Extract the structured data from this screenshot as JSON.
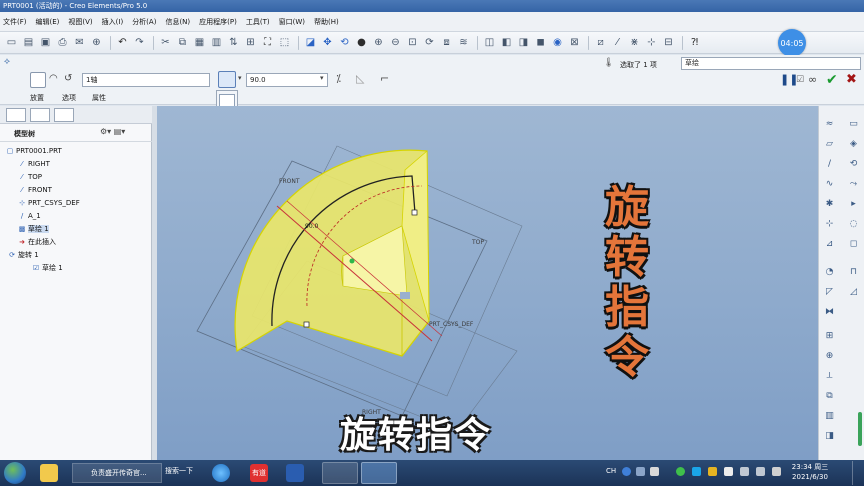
{
  "window": {
    "title": "PRT0001 (活动的) - Creo Elements/Pro 5.0"
  },
  "menu": {
    "items": [
      "文件(F)",
      "编辑(E)",
      "视图(V)",
      "插入(I)",
      "分析(A)",
      "信息(N)",
      "应用程序(P)",
      "工具(T)",
      "窗口(W)",
      "帮助(H)"
    ]
  },
  "toolbar": {
    "clock_bubble": "04:05"
  },
  "dashboard": {
    "type_value": "1轴",
    "angle_value": "90.0",
    "tabs": [
      "放置",
      "选项",
      "属性"
    ],
    "select_status": "选取了 1 项",
    "filter_value": "草绘"
  },
  "model_tree": {
    "header": "模型树",
    "nodes": [
      {
        "label": "PRT0001.PRT",
        "icon": "part-icon"
      },
      {
        "label": "RIGHT",
        "icon": "datum-plane-icon"
      },
      {
        "label": "TOP",
        "icon": "datum-plane-icon"
      },
      {
        "label": "FRONT",
        "icon": "datum-plane-icon"
      },
      {
        "label": "PRT_CSYS_DEF",
        "icon": "csys-icon"
      },
      {
        "label": "A_1",
        "icon": "datum-axis-icon"
      },
      {
        "label": "草绘 1",
        "icon": "sketch-icon"
      },
      {
        "label": "在此插入",
        "icon": "insert-arrow-icon"
      },
      {
        "label": "旋转 1",
        "icon": "revolve-icon"
      },
      {
        "label": "草绘 1",
        "icon": "sketch-icon"
      }
    ]
  },
  "canvas": {
    "plane_labels": {
      "front": "FRONT",
      "top": "TOP",
      "right": "RIGHT",
      "csys": "PRT_CSYS_DEF",
      "dimension": "90.0"
    },
    "overlay_vertical": [
      "旋",
      "转",
      "指",
      "令"
    ],
    "subtitle": "旋转指令",
    "colors": {
      "background_top": "#9fb7d3",
      "background_bottom": "#7f9ec6",
      "solid_fill": "#e9e66a",
      "solid_edge": "#d6d400",
      "overlay_text": "#e4753a"
    }
  },
  "taskbar": {
    "browser_task": "负责盛开传奇官...",
    "search_label": "搜索一下",
    "app_label": "有道",
    "lang": "CH",
    "time": "23:34 周三",
    "date": "2021/6/30"
  }
}
